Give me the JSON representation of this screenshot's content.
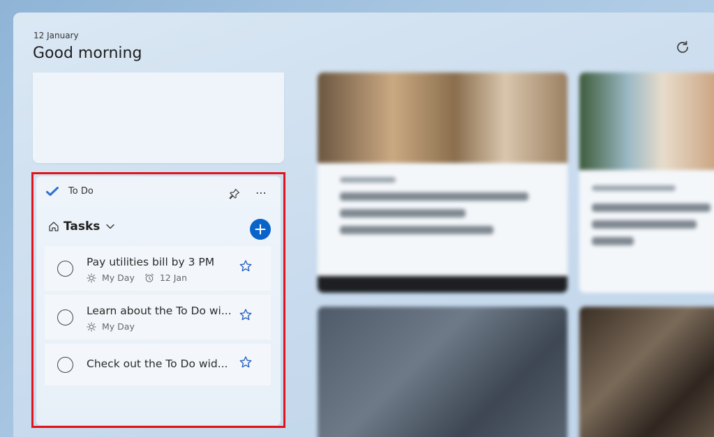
{
  "header": {
    "date": "12 January",
    "greeting": "Good morning"
  },
  "todo": {
    "app_name": "To Do",
    "list_name": "Tasks",
    "tasks": [
      {
        "title": "Pay utilities bill by 3 PM",
        "my_day": "My Day",
        "due": "12 Jan"
      },
      {
        "title": "Learn about the To Do wi...",
        "my_day": "My Day",
        "due": ""
      },
      {
        "title": "Check out the To Do wid...",
        "my_day": "",
        "due": ""
      }
    ]
  },
  "colors": {
    "accent": "#0a63c9",
    "highlight": "#e0141b"
  }
}
